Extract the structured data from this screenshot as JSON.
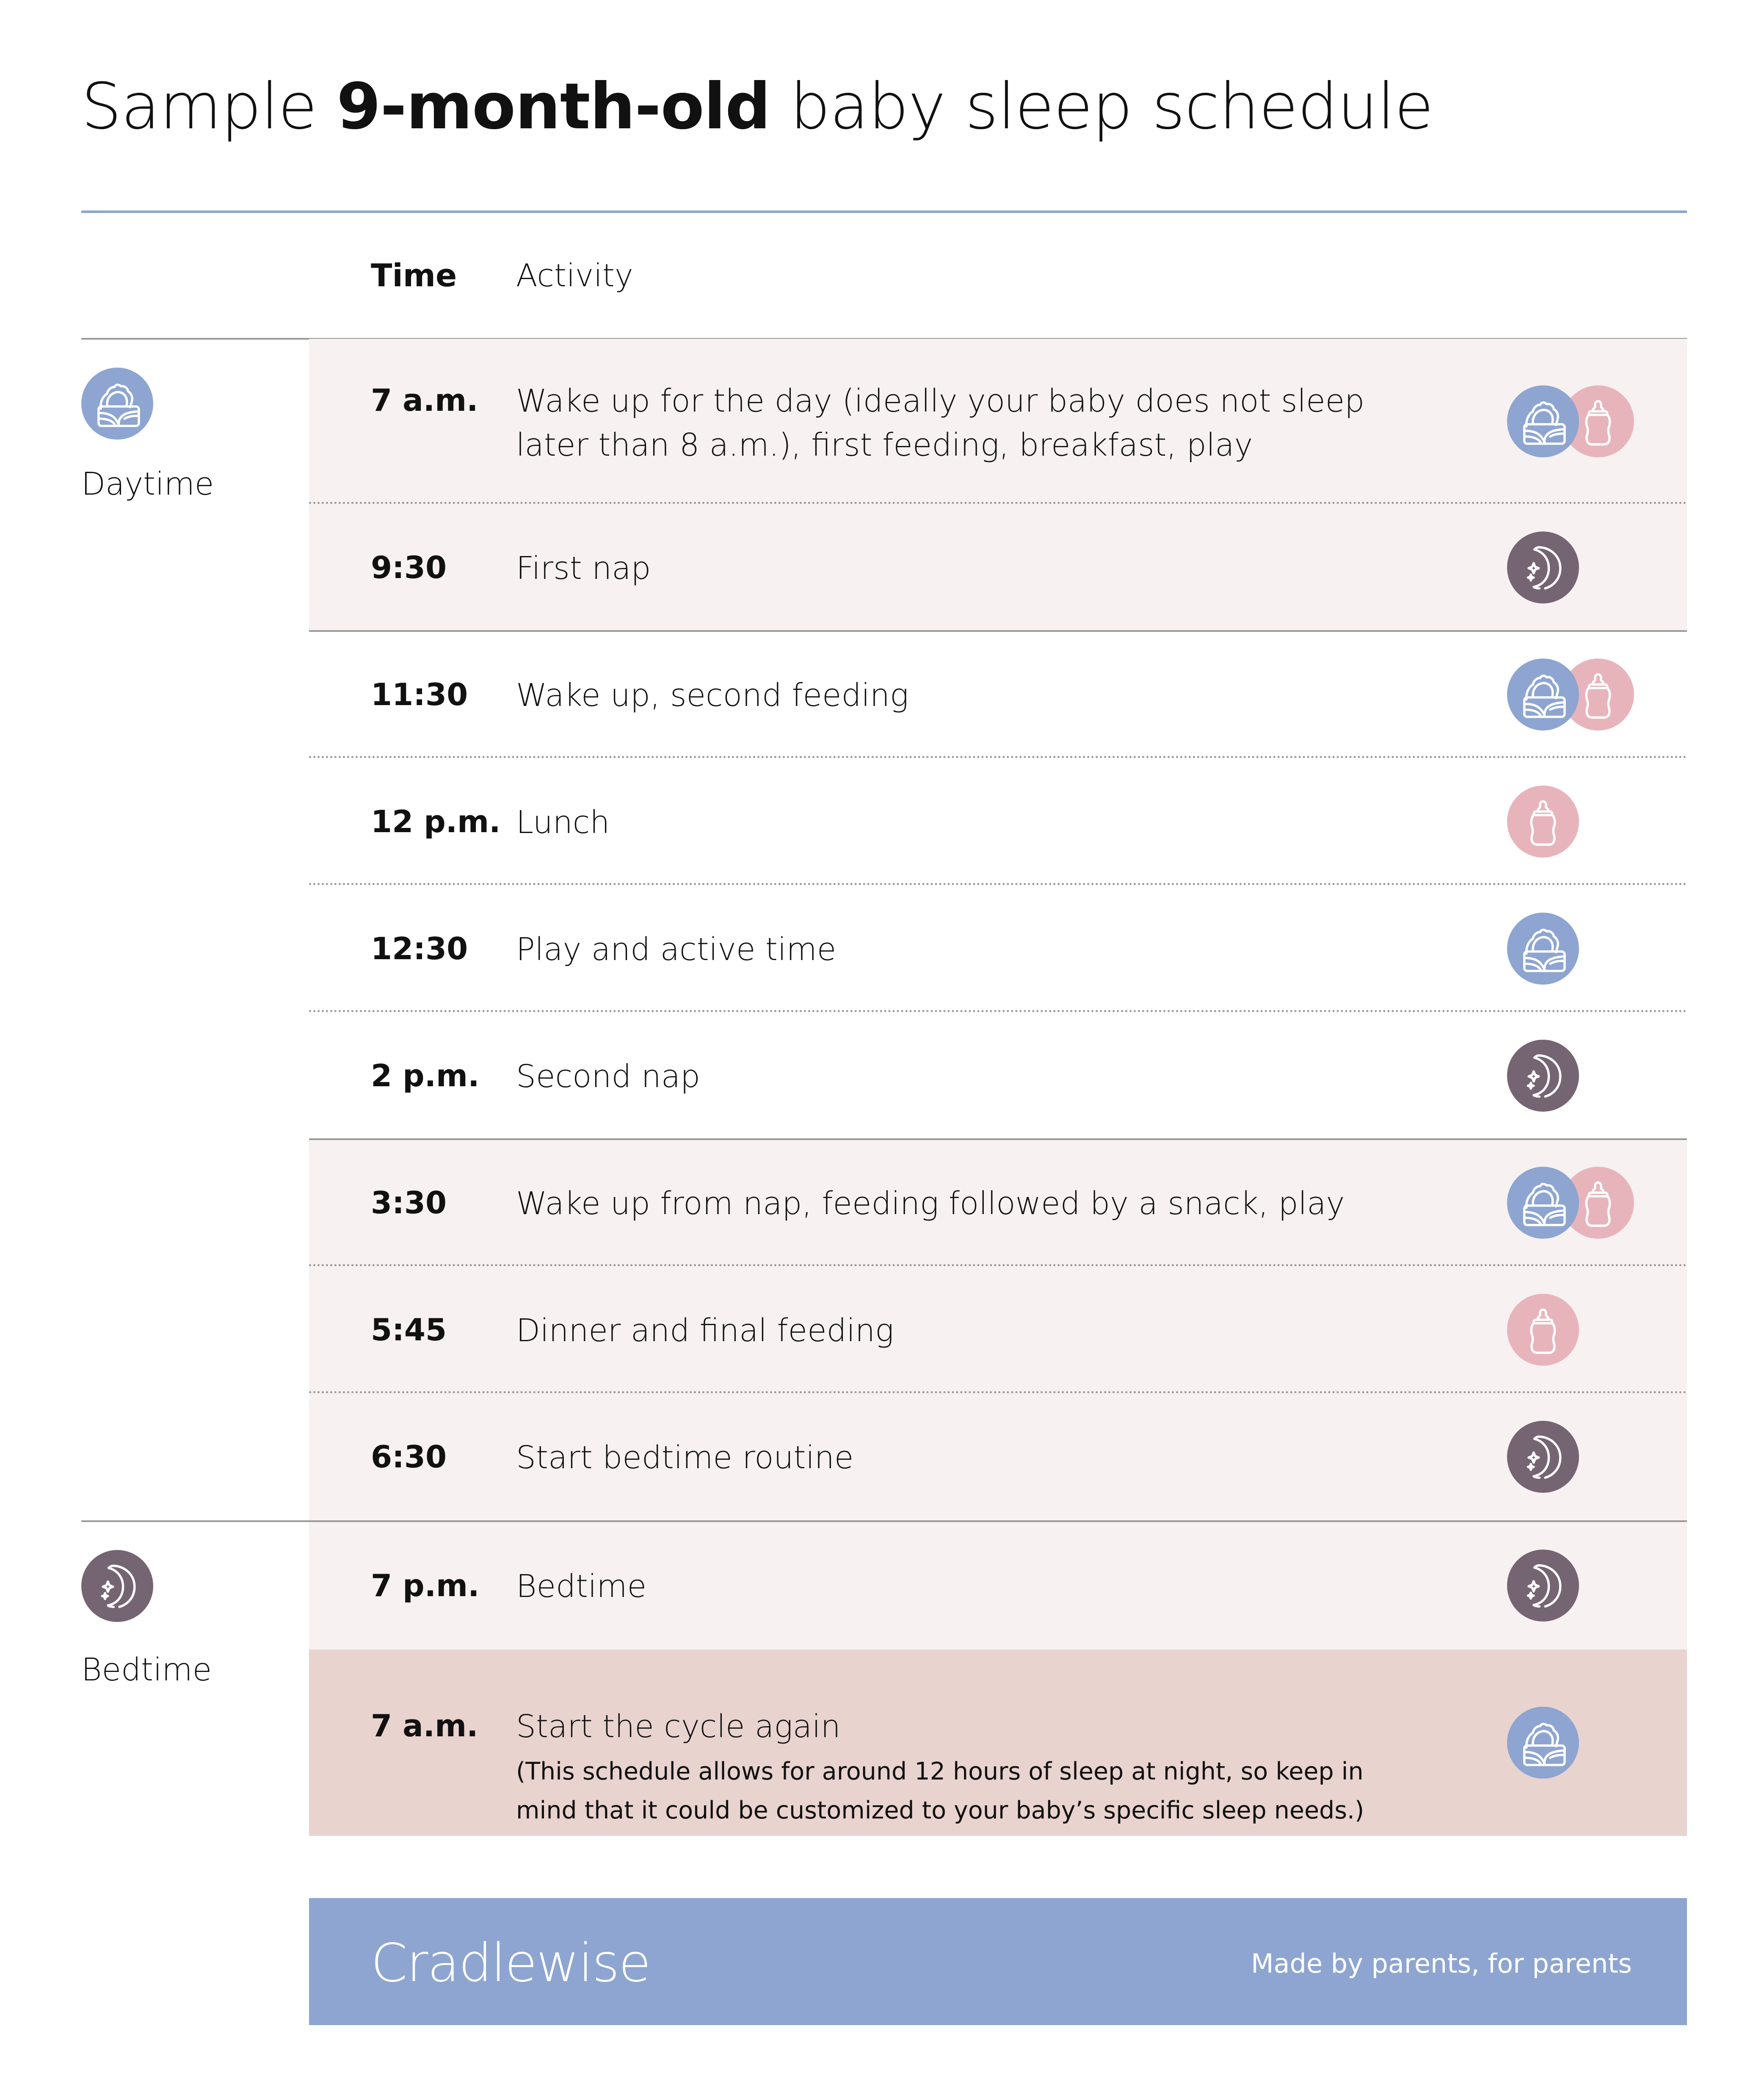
{
  "title": {
    "prefix": "Sample ",
    "bold": "9-month-old",
    "suffix": " baby sleep schedule"
  },
  "header": {
    "time": "Time",
    "activity": "Activity"
  },
  "sections": {
    "daytime": {
      "label": "Daytime",
      "icon": "sun-icon"
    },
    "bedtime": {
      "label": "Bedtime",
      "icon": "moon-icon"
    }
  },
  "rows": [
    {
      "time": "7 a.m.",
      "activity": "Wake up for the day (ideally your baby does not sleep later than 8 a.m.), first feeding, breakfast, play",
      "icons": [
        "sun",
        "bottle"
      ]
    },
    {
      "time": "9:30",
      "activity": "First nap",
      "icons": [
        "moon"
      ]
    },
    {
      "time": "11:30",
      "activity": "Wake up, second feeding",
      "icons": [
        "sun",
        "bottle"
      ]
    },
    {
      "time": "12 p.m.",
      "activity": "Lunch",
      "icons": [
        "bottle"
      ]
    },
    {
      "time": "12:30",
      "activity": "Play and active time",
      "icons": [
        "sun"
      ]
    },
    {
      "time": "2 p.m.",
      "activity": "Second nap",
      "icons": [
        "moon"
      ]
    },
    {
      "time": "3:30",
      "activity": "Wake up from nap, feeding followed by a snack, play",
      "icons": [
        "sun",
        "bottle"
      ]
    },
    {
      "time": "5:45",
      "activity": "Dinner and final feeding",
      "icons": [
        "bottle"
      ]
    },
    {
      "time": "6:30",
      "activity": "Start bedtime routine",
      "icons": [
        "moon"
      ]
    },
    {
      "time": "7 p.m.",
      "activity": "Bedtime",
      "icons": [
        "moon"
      ]
    },
    {
      "time": "7 a.m.",
      "activity": "Start the cycle again",
      "note": "(This schedule allows for around 12 hours of sleep at night, so keep in mind that it could be customized to your baby’s specific sleep needs.)",
      "icons": [
        "sun"
      ]
    }
  ],
  "footer": {
    "brand": "Cradlewise",
    "tagline": "Made by parents, for parents"
  },
  "colors": {
    "accent_blue": "#8DA5D0",
    "feeding_pink": "#E8B4BC",
    "sleep_purple": "#756572",
    "row_shade": "#F7F1F1",
    "final_row": "#E9D3CF"
  }
}
